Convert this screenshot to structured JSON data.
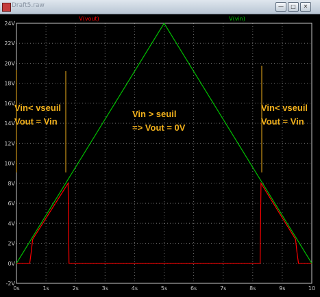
{
  "window": {
    "title": "Draft5.raw",
    "buttons": {
      "minimize": "—",
      "maximize": "□",
      "close": "✕"
    }
  },
  "colors": {
    "vout": "#ff0000",
    "vin": "#00c000",
    "annotation": "#f2b11c",
    "axis": "#c8c8c8",
    "grid": "#6e6e6e"
  },
  "annotations": {
    "left_line1": "Vin< vseuil",
    "left_line2": "Vout = Vin",
    "mid_line1": "Vin > seuil",
    "mid_line2": "=> Vout = 0V",
    "right_line1": "Vin< vseuil",
    "right_line2": "Vout = Vin"
  },
  "chart_data": {
    "type": "line",
    "xlim": [
      0,
      10
    ],
    "ylim": [
      -2,
      24
    ],
    "x_ticks": [
      "0s",
      "1s",
      "2s",
      "3s",
      "4s",
      "5s",
      "6s",
      "7s",
      "8s",
      "9s",
      "10"
    ],
    "y_ticks": [
      "-2V",
      "0V",
      "2V",
      "4V",
      "6V",
      "8V",
      "10V",
      "12V",
      "14V",
      "16V",
      "18V",
      "20V",
      "22V",
      "24V"
    ],
    "grid": true,
    "series": [
      {
        "name": "V(vout)",
        "color": "#ff0000",
        "points": [
          [
            0,
            0
          ],
          [
            0.45,
            0
          ],
          [
            0.5,
            1.1
          ],
          [
            0.55,
            2.4
          ],
          [
            1.75,
            8
          ],
          [
            1.78,
            0
          ],
          [
            8.25,
            0
          ],
          [
            8.28,
            8
          ],
          [
            9.45,
            2.4
          ],
          [
            9.5,
            1.1
          ],
          [
            9.55,
            0
          ],
          [
            10,
            0
          ]
        ]
      },
      {
        "name": "V(vin)",
        "color": "#00c000",
        "points": [
          [
            0,
            0
          ],
          [
            5,
            24
          ],
          [
            10,
            0
          ]
        ]
      }
    ]
  }
}
